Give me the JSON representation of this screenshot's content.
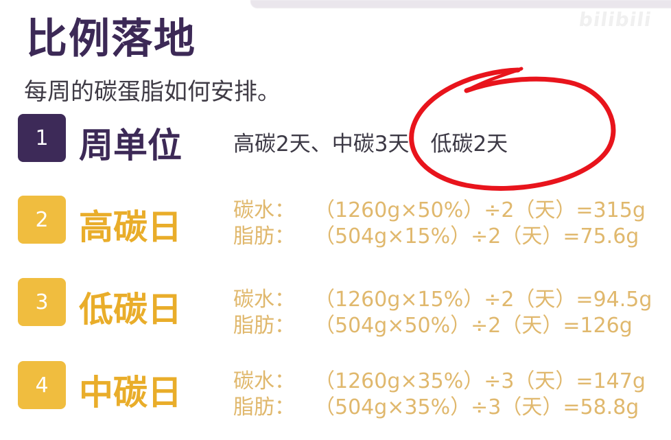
{
  "title": "比例落地",
  "subtitle": "每周的碳蛋脂如何安排。",
  "watermark": "bilibili",
  "rows": [
    {
      "number": "1",
      "label": "周单位",
      "text": "高碳2天、中碳3天、低碳2天"
    },
    {
      "number": "2",
      "label": "高碳日",
      "lines": [
        {
          "name": "碳水：",
          "formula": "（1260g×50%）÷2（天）=315g"
        },
        {
          "name": "脂肪：",
          "formula": "（504g×15%）÷2（天）=75.6g"
        }
      ]
    },
    {
      "number": "3",
      "label": "低碳日",
      "lines": [
        {
          "name": "碳水：",
          "formula": "（1260g×15%）÷2（天）=94.5g"
        },
        {
          "name": "脂肪：",
          "formula": "（504g×50%）÷2（天）=126g"
        }
      ]
    },
    {
      "number": "4",
      "label": "中碳日",
      "lines": [
        {
          "name": "碳水：",
          "formula": "（1260g×35%）÷3（天）=147g"
        },
        {
          "name": "脂肪：",
          "formula": "（504g×35%）÷3（天）=58.8g"
        }
      ]
    }
  ],
  "colors": {
    "purple": "#3d2a58",
    "gold": "#f0bd3f",
    "calc_text": "#e0b86d",
    "annotation_red": "#e8141c"
  }
}
